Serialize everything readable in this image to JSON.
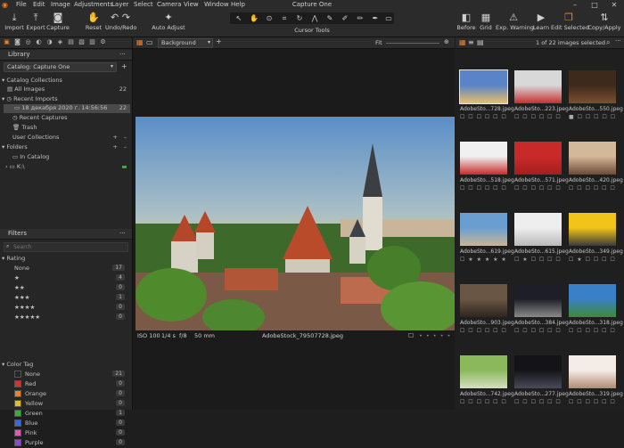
{
  "app": {
    "title": "Capture One"
  },
  "menu": [
    "File",
    "Edit",
    "Image",
    "Adjustments",
    "Layer",
    "Select",
    "Camera",
    "View",
    "Window",
    "Help"
  ],
  "toolbar": {
    "left": [
      {
        "label": "Import",
        "icon": "import-icon"
      },
      {
        "label": "Export",
        "icon": "export-icon"
      },
      {
        "label": "Capture",
        "icon": "camera-icon"
      },
      {
        "label": "Reset",
        "icon": "reset-icon"
      },
      {
        "label": "Undo/Redo",
        "icon": "undo-redo-icon"
      },
      {
        "label": "Auto Adjust",
        "icon": "auto-adjust-icon"
      }
    ],
    "cursor_tools_label": "Cursor Tools",
    "right": [
      {
        "label": "Before",
        "icon": "before-icon"
      },
      {
        "label": "Grid",
        "icon": "grid-icon"
      },
      {
        "label": "Exp. Warning",
        "icon": "warning-icon"
      },
      {
        "label": "Learn",
        "icon": "learn-icon"
      },
      {
        "label": "Edit Selected",
        "icon": "edit-selected-icon"
      },
      {
        "label": "Copy/Apply",
        "icon": "copy-apply-icon"
      }
    ]
  },
  "library": {
    "title": "Library",
    "catalog_select": "Catalog: Capture One",
    "catalog_collections_label": "Catalog Collections",
    "all_images": {
      "label": "All Images",
      "count": "22"
    },
    "recent_imports_label": "Recent Imports",
    "import_entry": {
      "label": "18 декабря 2020 г. 14:56:56",
      "count": "22"
    },
    "recent_captures": "Recent Captures",
    "trash": "Trash",
    "user_collections": "User Collections",
    "folders": "Folders",
    "in_catalog": "In Catalog",
    "drive": "K:\\"
  },
  "filters": {
    "title": "Filters",
    "search_placeholder": "Search",
    "rating_label": "Rating",
    "ratings": [
      {
        "label": "None",
        "count": "17"
      },
      {
        "label": "★",
        "count": "4"
      },
      {
        "label": "★★",
        "count": "0"
      },
      {
        "label": "★★★",
        "count": "1"
      },
      {
        "label": "★★★★",
        "count": "0"
      },
      {
        "label": "★★★★★",
        "count": "0"
      }
    ],
    "color_tag_label": "Color Tag",
    "color_tags": [
      {
        "label": "None",
        "count": "21",
        "color": "#262626"
      },
      {
        "label": "Red",
        "count": "0",
        "color": "#d93030"
      },
      {
        "label": "Orange",
        "count": "0",
        "color": "#e8832a"
      },
      {
        "label": "Yellow",
        "count": "0",
        "color": "#e0c020"
      },
      {
        "label": "Green",
        "count": "1",
        "color": "#3aaa3a"
      },
      {
        "label": "Blue",
        "count": "0",
        "color": "#3a6ad8"
      },
      {
        "label": "Pink",
        "count": "0",
        "color": "#e05ab0"
      },
      {
        "label": "Purple",
        "count": "0",
        "color": "#8a4ad8"
      }
    ]
  },
  "viewer": {
    "background_select": "Background",
    "fit_label": "Fit",
    "iso": "ISO 100",
    "shutter": "1/4 s",
    "aperture": "f/8",
    "focal": "50 mm",
    "filename": "AdobeStock_79507728.jpeg"
  },
  "browser": {
    "status": "1 of 22 images selected",
    "thumbs": [
      {
        "label": "AdobeSto...728.jpeg",
        "stars": "☐ ☐ ☐ ☐ ☐ ☐"
      },
      {
        "label": "AdobeSto...223.jpeg",
        "stars": "☐ ☐ ☐ ☐ ☐ ☐"
      },
      {
        "label": "AdobeSto...550.jpeg",
        "stars": "■ ☐ ☐ ☐ ☐ ☐"
      },
      {
        "label": "AdobeSto...518.jpeg",
        "stars": "☐ ☐ ☐ ☐ ☐ ☐"
      },
      {
        "label": "AdobeSto...571.jpeg",
        "stars": "☐ ☐ ☐ ☐ ☐ ☐"
      },
      {
        "label": "AdobeSto...420.jpeg",
        "stars": "☐ ☐ ☐ ☐ ☐ ☐"
      },
      {
        "label": "AdobeSto...619.jpeg",
        "stars": "☐ ★ ★ ★ ★ ★"
      },
      {
        "label": "AdobeSto...615.jpeg",
        "stars": "☐ ★ ☐ ☐ ☐ ☐"
      },
      {
        "label": "AdobeSto...349.jpeg",
        "stars": "☐ ★ ☐ ☐ ☐ ☐"
      },
      {
        "label": "AdobeSto...903.jpeg",
        "stars": "☐ ☐ ☐ ☐ ☐ ☐"
      },
      {
        "label": "AdobeSto...384.jpeg",
        "stars": "☐ ☐ ☐ ☐ ☐ ☐"
      },
      {
        "label": "AdobeSto...318.jpeg",
        "stars": "☐ ☐ ☐ ☐ ☐ ☐"
      },
      {
        "label": "AdobeSto...742.jpeg",
        "stars": "☐ ☐ ☐ ☐ ☐ ☐"
      },
      {
        "label": "AdobeSto...277.jpeg",
        "stars": "☐ ☐ ☐ ☐ ☐ ☐"
      },
      {
        "label": "AdobeSto...319.jpeg",
        "stars": "☐ ☐ ☐ ☐ ☐ ☐"
      }
    ]
  },
  "colors": {
    "accent": "#e8832a",
    "selection": "#4a4a4a"
  }
}
